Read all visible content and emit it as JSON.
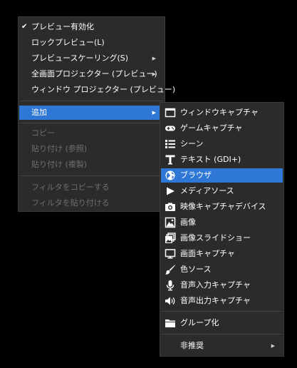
{
  "main_menu": {
    "items": [
      {
        "label": "プレビュー有効化",
        "checked": true
      },
      {
        "label": "ロックプレビュー(L)"
      },
      {
        "label": "プレビュースケーリング(S)",
        "submenu": true
      },
      {
        "label": "全画面プロジェクター (プレビュー)",
        "submenu": true
      },
      {
        "label": "ウィンドウ プロジェクター (プレビュー)"
      },
      {
        "label": "追加",
        "submenu": true,
        "highlighted": true
      },
      {
        "label": "コピー",
        "disabled": true
      },
      {
        "label": "貼り付け (参照)",
        "disabled": true
      },
      {
        "label": "貼り付け (複製)",
        "disabled": true
      },
      {
        "label": "フィルタをコピーする",
        "disabled": true
      },
      {
        "label": "フィルタを貼り付ける",
        "disabled": true
      }
    ]
  },
  "add_submenu": {
    "items": [
      {
        "label": "ウィンドウキャプチャ",
        "icon": "window-icon"
      },
      {
        "label": "ゲームキャプチャ",
        "icon": "gamepad-icon"
      },
      {
        "label": "シーン",
        "icon": "list-icon"
      },
      {
        "label": "テキスト (GDI+)",
        "icon": "text-icon"
      },
      {
        "label": "ブラウザ",
        "icon": "globe-icon",
        "highlighted": true
      },
      {
        "label": "メディアソース",
        "icon": "play-icon"
      },
      {
        "label": "映像キャプチャデバイス",
        "icon": "camera-icon"
      },
      {
        "label": "画像",
        "icon": "image-icon"
      },
      {
        "label": "画像スライドショー",
        "icon": "slideshow-icon"
      },
      {
        "label": "画面キャプチャ",
        "icon": "monitor-icon"
      },
      {
        "label": "色ソース",
        "icon": "brush-icon"
      },
      {
        "label": "音声入力キャプチャ",
        "icon": "microphone-icon"
      },
      {
        "label": "音声出力キャプチャ",
        "icon": "speaker-icon"
      },
      {
        "label": "グループ化",
        "icon": "folder-icon"
      },
      {
        "label": "非推奨",
        "submenu": true
      }
    ]
  },
  "glyphs": {
    "check": "✔",
    "arrow": "▶"
  },
  "colors": {
    "background": "#000000",
    "menu_bg": "#2b2b2b",
    "highlight": "#2f77d4",
    "text": "#ffffff",
    "disabled_text": "#6e6e6e",
    "separator": "#454545"
  }
}
